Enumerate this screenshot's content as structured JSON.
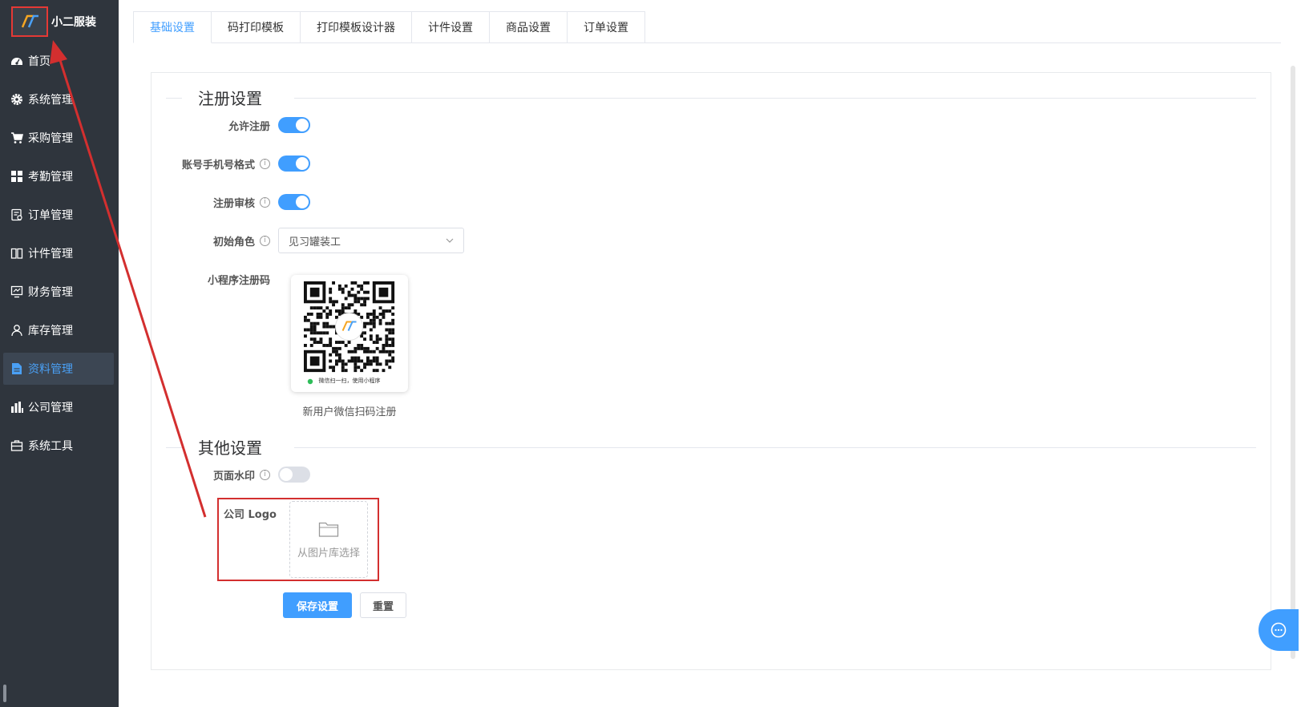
{
  "brand": {
    "name": "小二服装",
    "logo_text": "IT"
  },
  "sidebar": {
    "items": [
      {
        "label": "首页",
        "icon": "dashboard-icon"
      },
      {
        "label": "系统管理",
        "icon": "gear-icon"
      },
      {
        "label": "采购管理",
        "icon": "cart-icon"
      },
      {
        "label": "考勤管理",
        "icon": "grid-icon"
      },
      {
        "label": "订单管理",
        "icon": "order-icon"
      },
      {
        "label": "计件管理",
        "icon": "book-icon"
      },
      {
        "label": "财务管理",
        "icon": "finance-icon"
      },
      {
        "label": "库存管理",
        "icon": "user-icon"
      },
      {
        "label": "资料管理",
        "icon": "file-icon",
        "active": true
      },
      {
        "label": "公司管理",
        "icon": "bar-chart-icon"
      },
      {
        "label": "系统工具",
        "icon": "toolbox-icon"
      }
    ]
  },
  "tabs": [
    "基础设置",
    "码打印模板",
    "打印模板设计器",
    "计件设置",
    "商品设置",
    "订单设置"
  ],
  "register": {
    "title": "注册设置",
    "allow_register": {
      "label": "允许注册",
      "on": true
    },
    "phone_format": {
      "label": "账号手机号格式",
      "on": true
    },
    "review": {
      "label": "注册审核",
      "on": true
    },
    "initial_role": {
      "label": "初始角色",
      "value": "见习罐装工"
    },
    "miniapp_code": {
      "label": "小程序注册码",
      "qr_hint": "微信扫一扫，使用小程序",
      "caption": "新用户微信扫码注册"
    }
  },
  "other": {
    "title": "其他设置",
    "watermark": {
      "label": "页面水印",
      "on": false
    },
    "company_logo": {
      "label": "公司 Logo",
      "upload_text": "从图片库选择"
    }
  },
  "actions": {
    "save": "保存设置",
    "reset": "重置"
  },
  "info_icon": "i",
  "colors": {
    "primary": "#409eff",
    "sidebar_bg": "#2f353d",
    "annotation": "#d32f2f"
  }
}
